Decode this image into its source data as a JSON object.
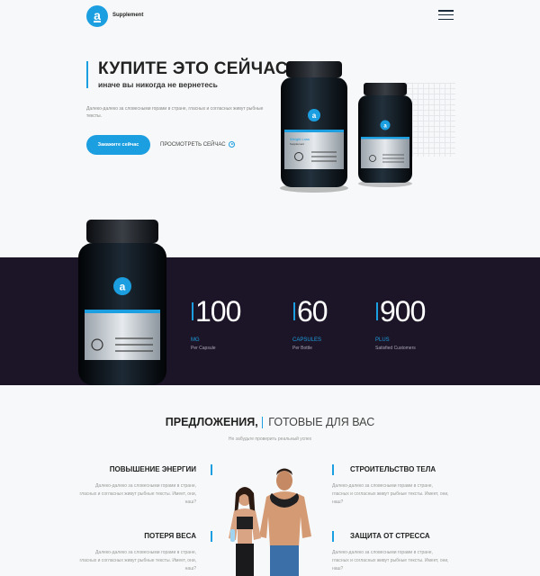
{
  "header": {
    "logo_letter": "a",
    "brand": "Supplement"
  },
  "hero": {
    "title": "КУПИТЕ ЭТО СЕЙЧАС",
    "subtitle": "иначе вы никогда не вернетесь",
    "text": "Далеко-далеко за словесными горами в стране, гласных и согласных живут рыбные тексты.",
    "order_button": "Закажите сейчас",
    "view_button": "ПРОСМОТРЕТЬ СЕЙЧАС"
  },
  "product": {
    "label_name": "Weight Loss",
    "label_sub": "Supplement"
  },
  "stats": [
    {
      "value": "100",
      "label": "MG",
      "desc": "Per Capsule"
    },
    {
      "value": "60",
      "label": "CAPSULES",
      "desc": "Per Bottle"
    },
    {
      "value": "900",
      "label": "PLUS",
      "desc": "Satisfied Customers"
    }
  ],
  "offers": {
    "title_strong": "ПРЕДЛОЖЕНИЯ,",
    "title_light": "ГОТОВЫЕ ДЛЯ ВАС",
    "subtitle": "Не забудьте проверить реальный успех",
    "features": [
      {
        "title": "ПОВЫШЕНИЕ ЭНЕРГИИ",
        "text": "Далеко-далеко за словесными горами в стране, гласных и согласных живут рыбные тексты. Имеет, они, наш?"
      },
      {
        "title": "СТРОИТЕЛЬСТВО ТЕЛА",
        "text": "Далеко-далеко за словесными горами в стране, гласных и согласных живут рыбные тексты. Имеет, они, наш?"
      },
      {
        "title": "ПОТЕРЯ ВЕСА",
        "text": "Далеко-далеко за словесными горами в стране, гласных и согласных живут рыбные тексты. Имеет, они, наш?"
      },
      {
        "title": "ЗАЩИТА ОТ СТРЕССА",
        "text": "Далеко-далеко за словесными горами в стране, гласных и согласных живут рыбные тексты. Имеет, они, наш?"
      }
    ]
  },
  "colors": {
    "accent": "#1c9fe0",
    "band": "#1c1528",
    "bottle": "#101418"
  },
  "icons": [
    "hamburger-menu-icon",
    "play-circle-icon",
    "recycle-icon"
  ]
}
